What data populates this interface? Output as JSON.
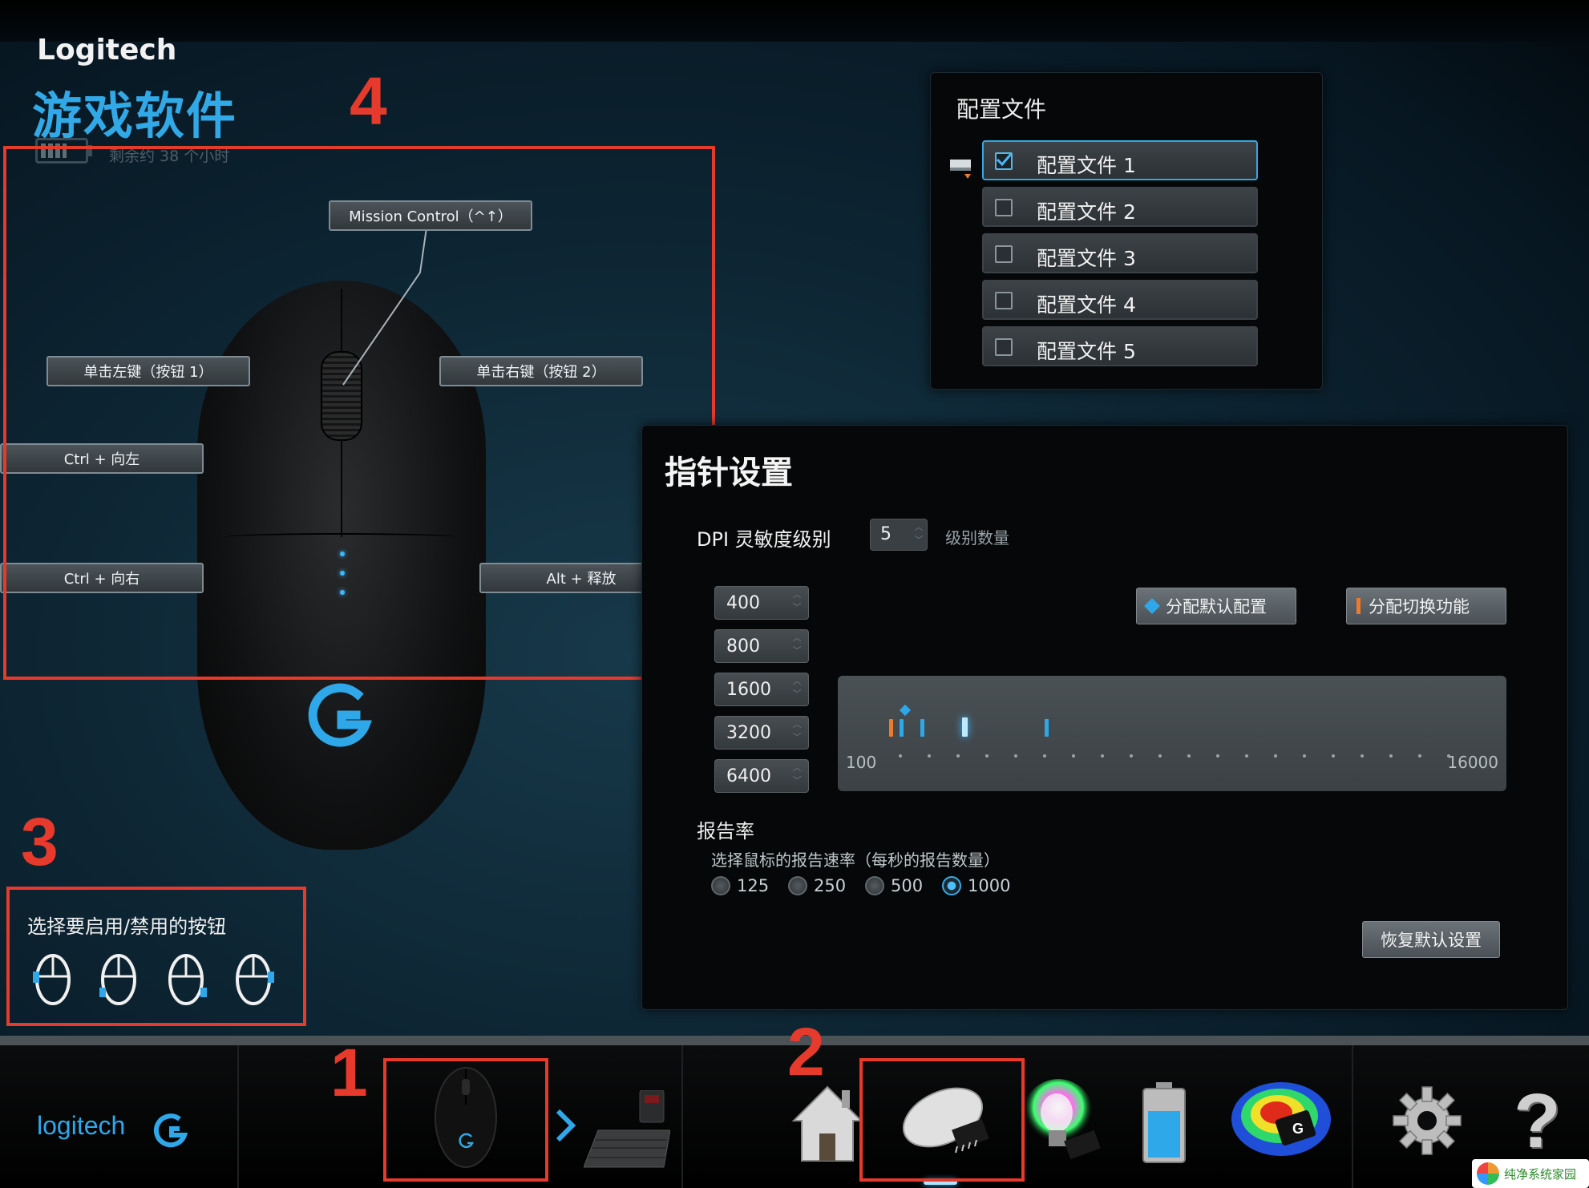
{
  "header": {
    "brand": "Logitech",
    "app_title": "游戏软件",
    "battery_text": "剩余约 38 个小时",
    "battery_level": 0.6
  },
  "annotations": {
    "num1": "1",
    "num2": "2",
    "num3": "3",
    "num4": "4",
    "color": "#e53a2c"
  },
  "mouse_callouts": {
    "middle": "Mission Control（^↑）",
    "left_click": "单击左键（按钮 1）",
    "right_click": "单击右键（按钮 2）",
    "ctrl_left": "Ctrl + 向左",
    "ctrl_right": "Ctrl + 向右",
    "alt_release": "Alt + 释放"
  },
  "button_toggle": {
    "title": "选择要启用/禁用的按钮"
  },
  "profiles": {
    "title": "配置文件",
    "items": [
      {
        "label": "配置文件 1",
        "checked": true
      },
      {
        "label": "配置文件 2",
        "checked": false
      },
      {
        "label": "配置文件 3",
        "checked": false
      },
      {
        "label": "配置文件 4",
        "checked": false
      },
      {
        "label": "配置文件 5",
        "checked": false
      }
    ]
  },
  "pointer": {
    "title": "指针设置",
    "dpi_label": "DPI 灵敏度级别",
    "dpi_count": "5",
    "dpi_count_label": "级别数量",
    "dpi_levels": [
      "400",
      "800",
      "1600",
      "3200",
      "6400"
    ],
    "assign_default": "分配默认配置",
    "assign_shift": "分配切换功能",
    "track_min": "100",
    "track_max": "16000",
    "report_title": "报告率",
    "report_desc": "选择鼠标的报告速率（每秒的报告数量）",
    "report_options": [
      "125",
      "250",
      "500",
      "1000"
    ],
    "report_selected": "1000",
    "restore": "恢复默认设置"
  },
  "bottom_bar": {
    "brand": "logitech",
    "icons": [
      "mouse-device-icon",
      "next-arrow-icon",
      "keyboard-device-icon",
      "home-icon",
      "pointer-settings-icon",
      "lighting-icon",
      "battery-icon",
      "heatmap-icon",
      "settings-gear-icon",
      "help-icon"
    ]
  },
  "colors": {
    "accent": "#2fa8ea",
    "title_blue": "#31a9e6",
    "shift_orange": "#f07a28"
  },
  "watermark": {
    "text": "纯净系统家园"
  }
}
